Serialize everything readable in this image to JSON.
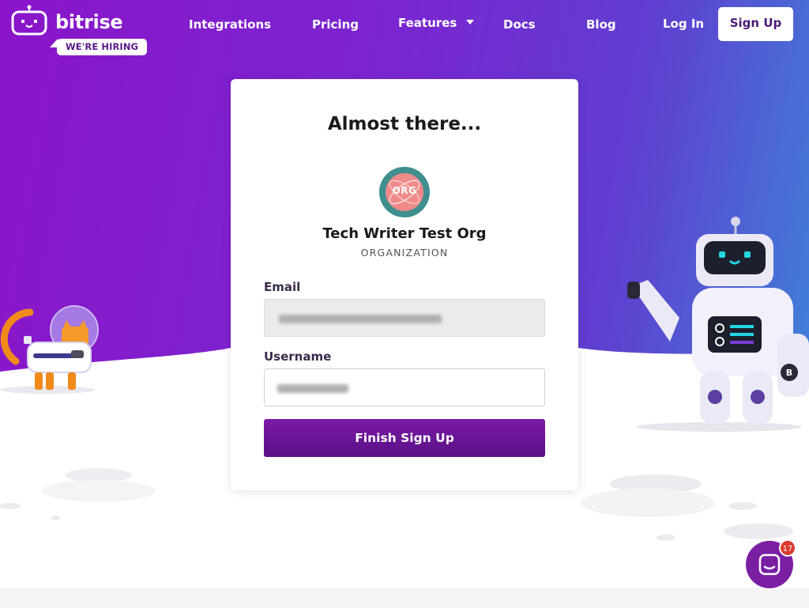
{
  "nav": {
    "brand": "bitrise",
    "hiring_badge": "WE'RE HIRING",
    "links": [
      "Integrations",
      "Pricing",
      "Features",
      "Docs",
      "Blog",
      "Log In"
    ],
    "signup_label": "Sign Up"
  },
  "card": {
    "title": "Almost there...",
    "org_avatar_text": "ORG",
    "org_name": "Tech Writer Test Org",
    "org_type": "ORGANIZATION",
    "email_label": "Email",
    "username_label": "Username",
    "submit_label": "Finish Sign Up"
  },
  "chat": {
    "badge_count": "17"
  },
  "colors": {
    "brand_purple": "#7b1aa6",
    "sky_start": "#8a15c9",
    "sky_end": "#3f80d8"
  }
}
